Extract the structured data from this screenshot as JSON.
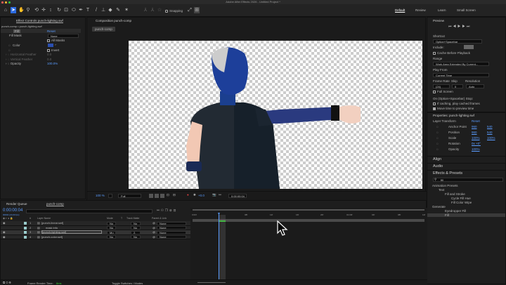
{
  "app": {
    "title": "Adobe After Effects 2026 - Untitled Project *"
  },
  "toolbar": {
    "snapping": "Snapping",
    "workspaces": [
      "Default",
      "Review",
      "Learn",
      "Small Screen"
    ],
    "active_workspace": "Default"
  },
  "effect_controls": {
    "tab": "Effect Controls punch-lighting.swf",
    "breadcrumb": "punch-comp • punch-lighting.swf",
    "effect_name": "Fill",
    "reset": "Reset",
    "props": [
      {
        "label": "Fill Mask",
        "value": "None"
      },
      {
        "label": "",
        "value": "All Masks"
      },
      {
        "label": "Color",
        "value": ""
      },
      {
        "label": "",
        "value": "Invert"
      },
      {
        "label": "Horizontal Feather",
        "value": "0.0"
      },
      {
        "label": "Vertical Feather",
        "value": "0.0"
      },
      {
        "label": "Opacity",
        "value": "100.0%"
      }
    ],
    "fill_color": "#2a4fb0"
  },
  "composition": {
    "tab": "Composition punch-comp",
    "comp_button": "punch-comp",
    "zoom": "100 %",
    "resolution": "Full",
    "timecode": "0:00:00:04",
    "exposure": "+0.0"
  },
  "preview": {
    "title": "Preview",
    "shortcut_label": "Shortcut",
    "shortcut": "Option+Spacebar",
    "include": "Include:",
    "cache": "Cache Before Playback",
    "range_label": "Range",
    "range": "Work Area Extended By Current...",
    "play_from_label": "Play From",
    "play_from": "Current Time",
    "frame_rate_label": "Frame Rate",
    "skip_label": "Skip",
    "resolution_label": "Resolution",
    "frame_rate": "(24)",
    "skip": "0",
    "resolution": "Auto",
    "full_screen": "Full Screen",
    "on_stop": "On (Option+Spacebar) Stop:",
    "if_caching": "If caching, play cached frames",
    "move_time": "Move time to preview time",
    "move_time_checked": true
  },
  "properties": {
    "title": "Properties: punch-lighting.swf",
    "section": "Layer Transform",
    "reset": "Reset",
    "rows": [
      {
        "label": "Anchor Point",
        "v1": "960",
        "v2": "540"
      },
      {
        "label": "Position",
        "v1": "960",
        "v2": "540"
      },
      {
        "label": "Scale",
        "v1": "100%",
        "v2": "100%"
      },
      {
        "label": "Rotation",
        "v1": "0x +0°",
        "v2": ""
      },
      {
        "label": "Opacity",
        "v1": "100%",
        "v2": ""
      }
    ]
  },
  "panels": {
    "align": "Align",
    "audio": "Audio",
    "effects_presets": "Effects & Presets",
    "search": "fill"
  },
  "presets_tree": [
    "Animation Presets",
    "Text",
    "Fill and Stroke",
    "Cycle Fill Hue",
    "Fill Color Wipe",
    "Generate",
    "Eyedropper Fill",
    "Fill"
  ],
  "timeline": {
    "tabs": [
      "Render Queue",
      "punch-comp"
    ],
    "timecode": "0:00:00:04",
    "fps": "00004 (24.00 fps)",
    "headers": [
      "#",
      "Layer Name",
      "Mode",
      "T",
      "Track Matte",
      "Parent & Link"
    ],
    "layers": [
      {
        "n": "1",
        "name": "[punch-linear.swf]",
        "mode": "No",
        "matte": "No",
        "parent": "None"
      },
      {
        "n": "2",
        "name": "mask info",
        "mode": "No",
        "matte": "No",
        "parent": "None"
      },
      {
        "n": "3",
        "name": "[punch-lighting.swf]",
        "mode": "Mu",
        "matte": "2.",
        "parent": "None"
      },
      {
        "n": "4",
        "name": "[punch-color.swf]",
        "mode": "No",
        "matte": "No",
        "parent": "None"
      }
    ],
    "ruler": [
      "0:00f",
      "08f",
      "12f",
      "16f",
      "20f",
      "01:00f",
      "04f",
      "08f",
      "12f"
    ],
    "render_time_label": "Frame Render Time:",
    "render_time": "8ms",
    "toggle": "Toggle Switches / Modes"
  }
}
